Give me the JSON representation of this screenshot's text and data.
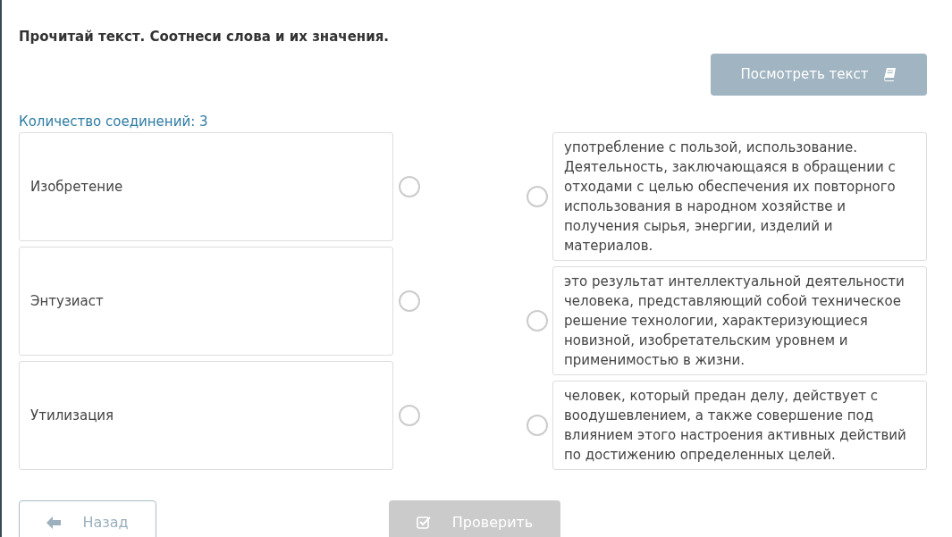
{
  "instruction": "Прочитай текст. Соотнеси слова и их значения.",
  "view_text_button": {
    "label": "Посмотреть текст"
  },
  "connections_count": "Количество соединений: 3",
  "terms": [
    {
      "text": "Изобретение"
    },
    {
      "text": "Энтузиаст"
    },
    {
      "text": "Утилизация"
    }
  ],
  "definitions": [
    {
      "text": "употребление с пользой, использование. Деятельность, заключающаяся в обращении с отходами с целью обеспечения их повторного использования в народном хозяйстве и получения сырья, энергии, изделий и материалов."
    },
    {
      "text": "это результат интеллектуальной деятельности человека, представляющий собой техническое решение технологии, характеризующиеся новизной, изобретательским уровнем и применимостью в жизни."
    },
    {
      "text": "человек, который предан делу, действует с воодушевлением, а также совершение под влиянием этого настроения активных действий по достижению определенных целей."
    }
  ],
  "back_button": {
    "label": "Назад",
    "disabled": false
  },
  "check_button": {
    "label": "Проверить",
    "disabled": true
  }
}
